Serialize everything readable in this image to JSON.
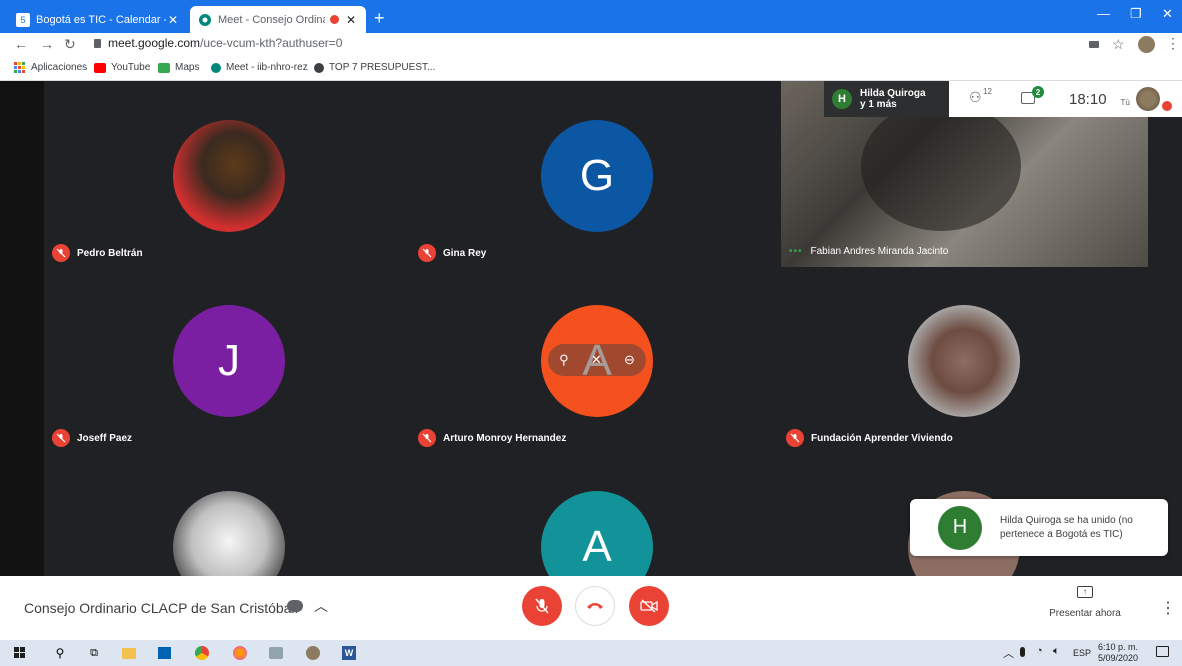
{
  "browser": {
    "tabs": [
      {
        "title": "Bogotá es TIC - Calendar - sábado",
        "favicon_text": "5"
      },
      {
        "title": "Meet - Consejo Ordinario CL",
        "active": true
      }
    ],
    "new_tab": "+",
    "url_main": "meet.google.com",
    "url_path": "/uce-vcum-kth?authuser=0",
    "bookmarks": [
      "Aplicaciones",
      "YouTube",
      "Maps",
      "Meet - iib-nhro-rez",
      "TOP 7 PRESUPUEST..."
    ]
  },
  "meeting": {
    "participants": [
      {
        "name": "Pedro Beltrán",
        "initial": "",
        "color": "#c62828",
        "photo": true
      },
      {
        "name": "Gina Rey",
        "initial": "G",
        "color": "#0b57a4"
      },
      {
        "name": "Fabian Andres Miranda Jacinto",
        "video": true
      },
      {
        "name": "Joseff Paez",
        "initial": "J",
        "color": "#7b1fa2"
      },
      {
        "name": "Arturo Monroy Hernandez",
        "initial": "A",
        "color": "#f4511e"
      },
      {
        "name": "Fundación Aprender Viviendo",
        "initial": "",
        "color": "#9e9e9e",
        "photo": true
      },
      {
        "name": "",
        "initial": "",
        "color": "#bdbdbd",
        "photo": true
      },
      {
        "name": "",
        "initial": "A",
        "color": "#12939a"
      }
    ],
    "speaker_initial": "H",
    "speaker_line1": "Hilda Quiroga",
    "speaker_line2": "y 1 más",
    "people_count": "12",
    "chat_count": "2",
    "time": "18:10",
    "you_label": "Tú",
    "toast_initial": "H",
    "toast_text": "Hilda Quiroga se ha unido (no pertenece a Bogotá es TIC)",
    "title": "Consejo Ordinario CLACP de San Cristóbal.",
    "present_label": "Presentar ahora"
  },
  "taskbar": {
    "lang": "ESP",
    "time": "6:10 p. m.",
    "date": "5/09/2020"
  }
}
